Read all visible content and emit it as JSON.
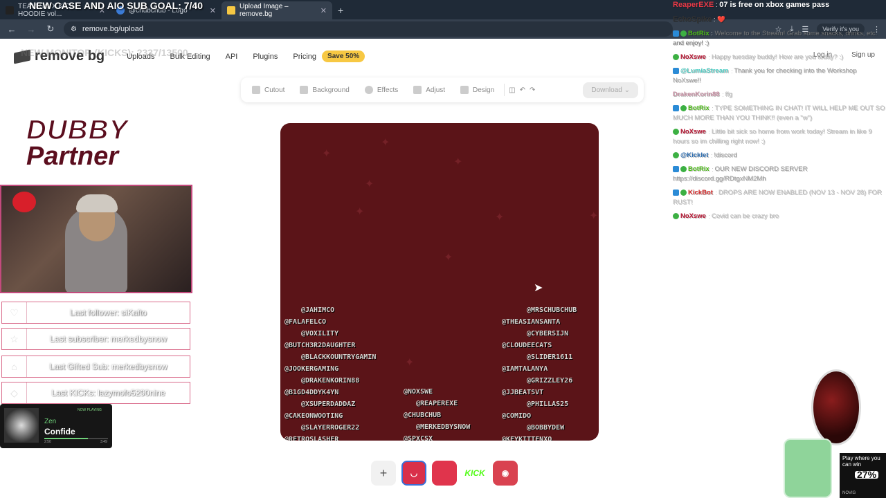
{
  "browser": {
    "tabs": [
      {
        "label": "TEAM GG X KICK HOODIE vol..."
      },
      {
        "label": "@chubchub - Logo"
      },
      {
        "label": "Upload Image – remove.bg"
      }
    ],
    "new_tab": "+",
    "url": "remove.bg/upload",
    "verify_label": "Verify it's you"
  },
  "site": {
    "logo": "remove bg",
    "nav": [
      "Uploads",
      "Bulk Editing",
      "API",
      "Plugins",
      "Pricing"
    ],
    "save_badge": "Save 50%",
    "login": "Log in",
    "signup": "Sign up"
  },
  "toolbar": {
    "items": [
      "Cutout",
      "Background",
      "Effects",
      "Adjust",
      "Design"
    ],
    "download": "Download"
  },
  "canvas": {
    "names_left": [
      "@JAHIMCO",
      "@FALAFELCO",
      "@VOXILITY",
      "@BUTCH3R2DAUGHTER",
      "@BLACKKOUNTRYGAMIN",
      "@JOOKERGAMING",
      "@DRAKENKORIN88",
      "@B1GD4DDYK4YN",
      "@XSUPERDADDAZ",
      "@CAKEONWOOTING",
      "@SLAYERROGER22",
      "@RETROSLASHER"
    ],
    "names_middle": [
      "@NOXSWE",
      "@REAPEREXE",
      "@CHUBCHUB",
      "@MERKEDBYSNOW",
      "@SPXCSX"
    ],
    "names_right": [
      "@MRSCHUBCHUB",
      "@THEASIANSANTA",
      "@CYBERSIJN",
      "@CLOUDEECATS",
      "@SLIDER1611",
      "@IAMTALANYA",
      "@GRIZZLEY26",
      "@JJBEATSVT",
      "@PHILLAS25",
      "@COMIDO",
      "@BOBBYDEW",
      "@KEYKITTENXO"
    ]
  },
  "thumbnails": {
    "add": "+",
    "kick": "KICK"
  },
  "overlay": {
    "title": "NEW CASE AND AIO SUB GOAL: 7/40",
    "monitor": "NEW MONITOR (KICKS): 2337/13500",
    "partner_line1": "DUBBY",
    "partner_line2": "Partner",
    "last_follower": "Last follower: siKafto",
    "last_subscriber": "Last subscriber: merkedbysnow",
    "last_gifted": "Last Gifted Sub: merkedbysnow",
    "last_kicks": "Last KICKs: lazymofo5290nine",
    "now_playing_tag": "NOW PLAYING",
    "np_artist": "Zen",
    "np_song": "Confide",
    "np_elapsed": "2:50",
    "np_total": "3:49",
    "np_progress": 0.68
  },
  "chat": [
    {
      "user": "ReaperEXE",
      "user_color": "#e63946",
      "text": "07 is free on xbox games pass",
      "text_color": "#ffffff"
    },
    {
      "user": "EchoSpike",
      "user_color": "#333333",
      "text": "❤️",
      "text_color": "#e63946"
    },
    {
      "user": "BotRix",
      "user_color": "#4cbb17",
      "text": "Welcome to the Stream! Grab some snacks, drinks, etc. and enjoy! :)",
      "text_color": "#777777"
    },
    {
      "user": "NoXswe",
      "user_color": "#b5122f",
      "text": "Happy tuesday buddy! How are you today? :)",
      "text_color": "#bbbbbb"
    },
    {
      "user": "@LumiaStream",
      "user_color": "#4ecdc4",
      "text": "Thank you for checking into the Workshop NoXswe!!",
      "text_color": "#999999"
    },
    {
      "user": "DrakenKorin88",
      "user_color": "#c48b9f",
      "text": "ffg",
      "text_color": "#bbbbbb"
    },
    {
      "user": "BotRix",
      "user_color": "#4cbb17",
      "text": "TYPE SOMETHING IN CHAT! IT WILL HELP ME OUT SO MUCH MORE THAN YOU THINK!! (even a \"w\")",
      "text_color": "#bbbbbb"
    },
    {
      "user": "NoXswe",
      "user_color": "#b5122f",
      "text": "Little bit sick so home from work today! Stream in like 9 hours so im chilling right now! :)",
      "text_color": "#bbbbbb"
    },
    {
      "user": "@Kicklet",
      "user_color": "#2b6cb0",
      "text": "!discord",
      "text_color": "#999999"
    },
    {
      "user": "BotRix",
      "user_color": "#4cbb17",
      "text": "OUR NEW DISCORD SERVER https://discord.gg/RDtgxNM2Mh",
      "text_color": "#999999"
    },
    {
      "user": "KickBot",
      "user_color": "#d62828",
      "text": "DROPS ARE NOW ENABLED (NOV 13 - NOV 28) FOR RUST!",
      "text_color": "#bbbbbb"
    },
    {
      "user": "NoXswe",
      "user_color": "#b5122f",
      "text": "Covid can be crazy bro",
      "text_color": "#bbbbbb"
    }
  ],
  "ad": {
    "text": "Play where you can win",
    "percent": "27%",
    "brand": "NOVIG"
  },
  "colors": {
    "canvas_bg": "#5b1418",
    "save_badge": "#f7c843",
    "overlay_accent": "#c34a7d"
  }
}
